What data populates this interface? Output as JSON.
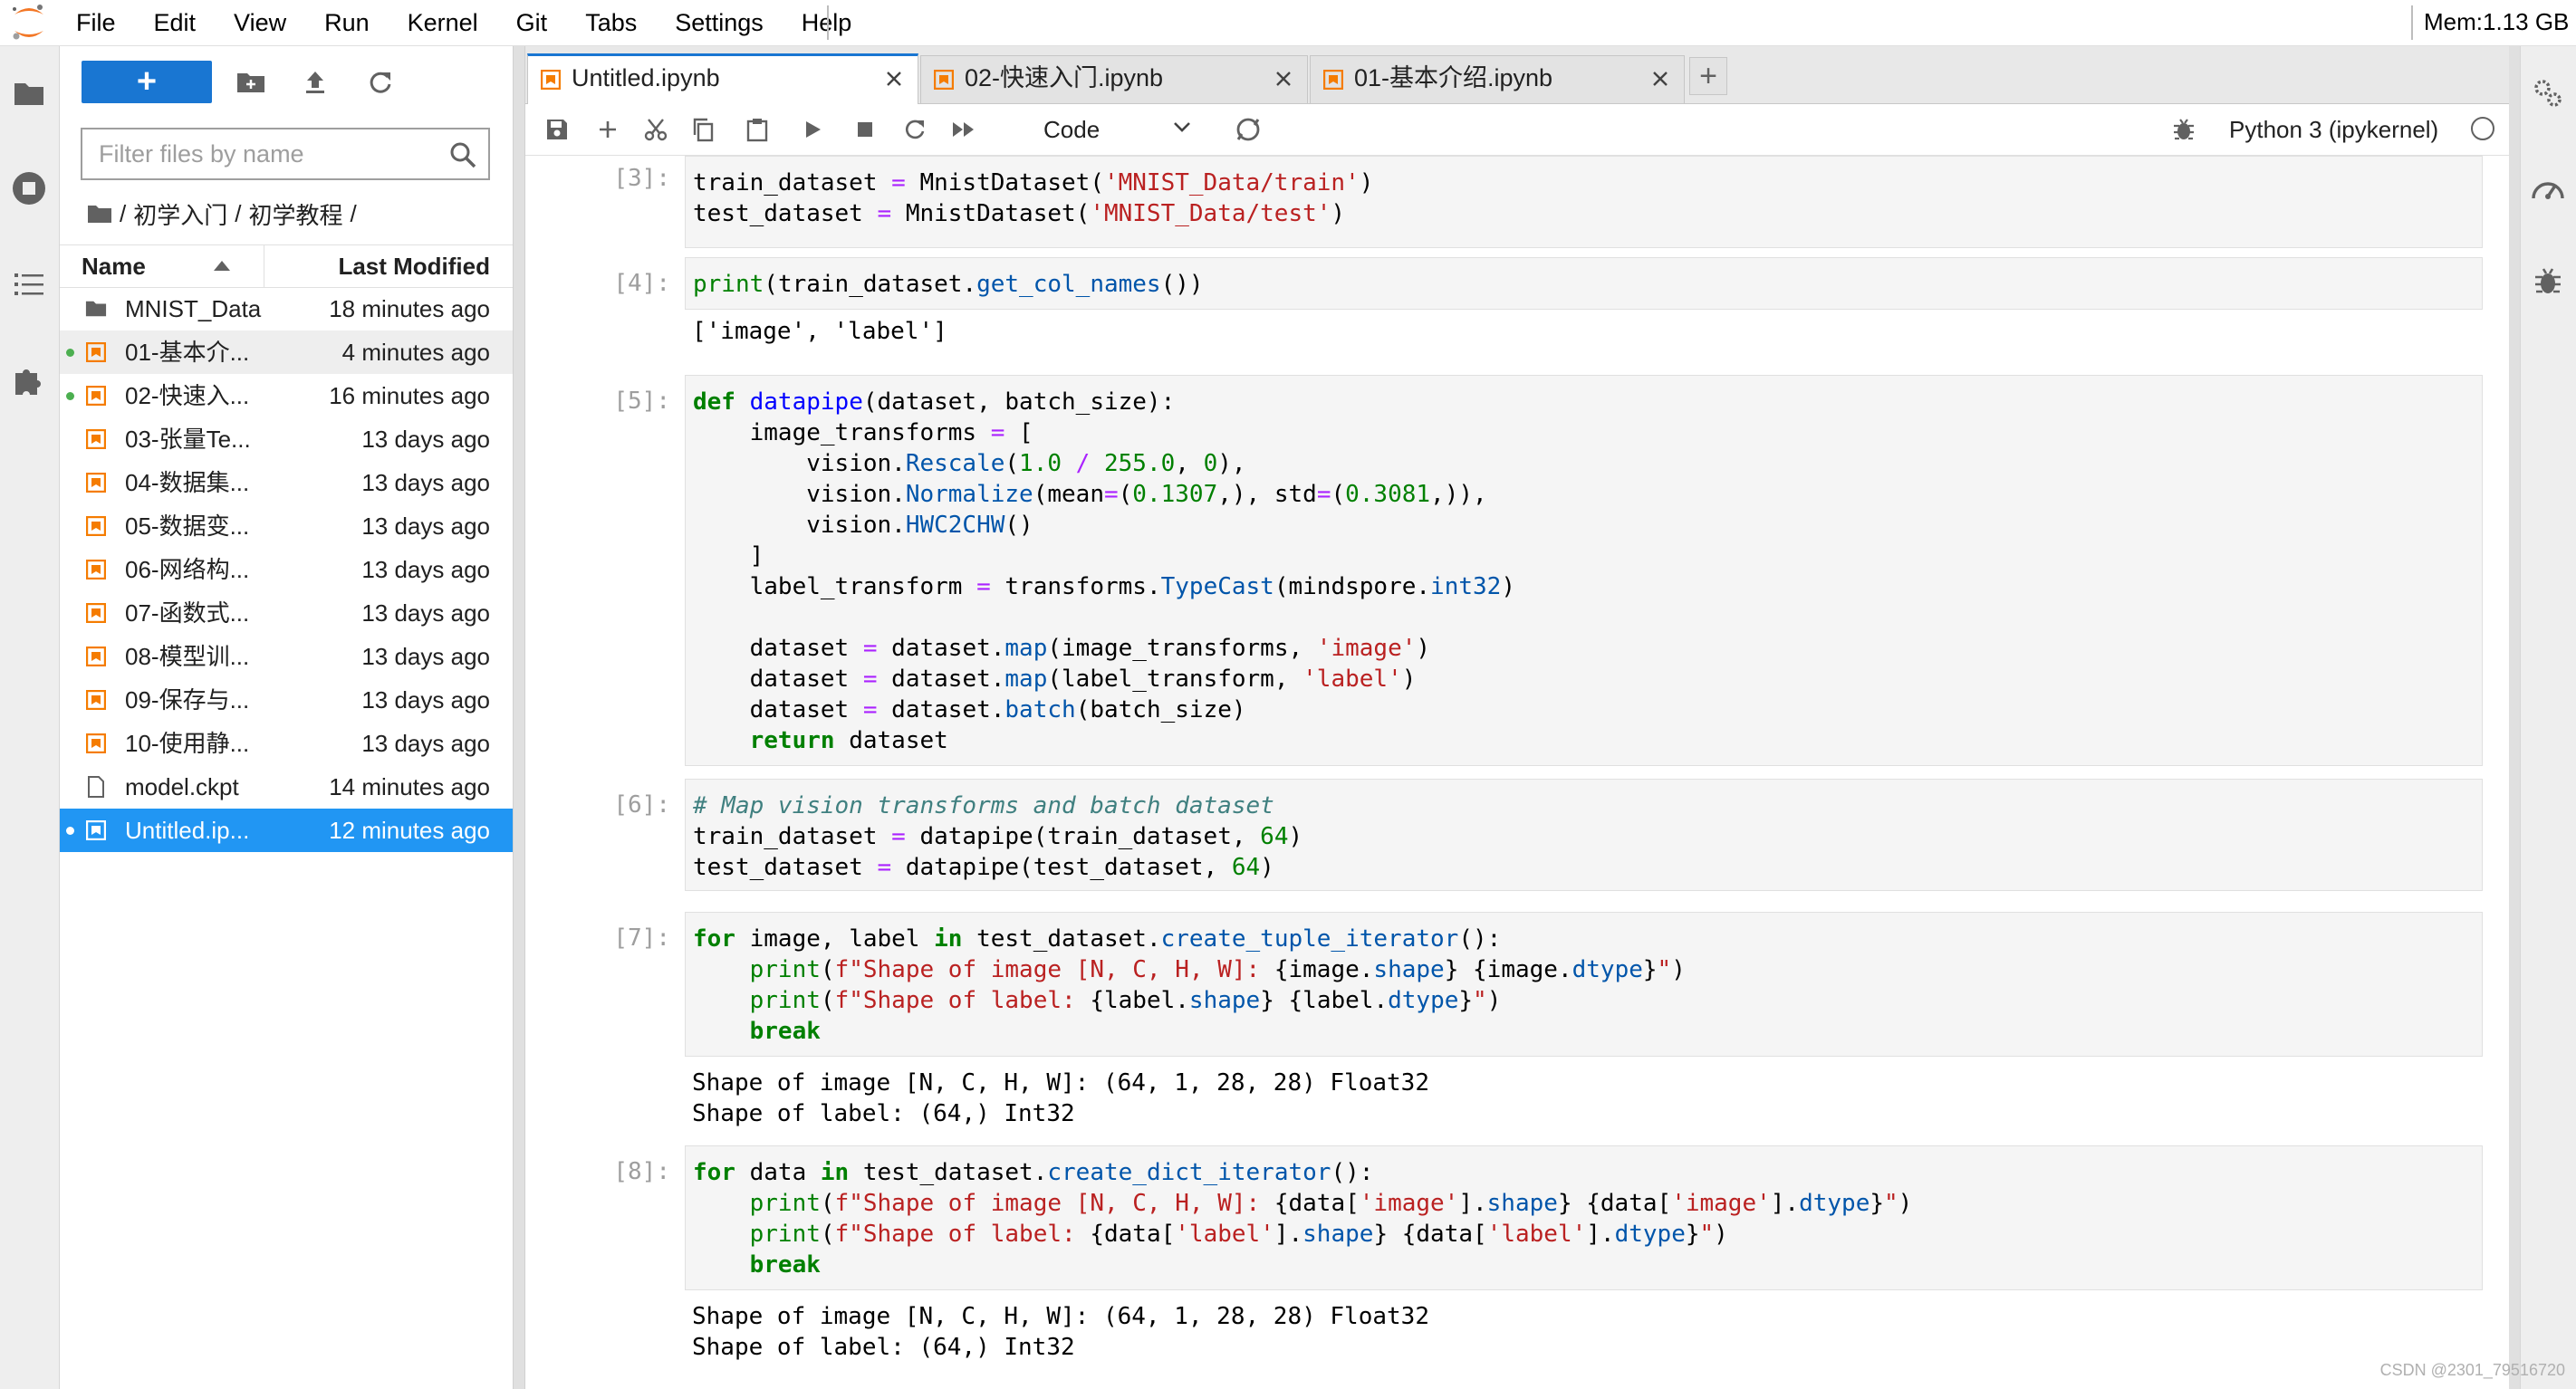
{
  "menubar": {
    "items": [
      "File",
      "Edit",
      "View",
      "Run",
      "Kernel",
      "Git",
      "Tabs",
      "Settings",
      "Help"
    ],
    "memory": "Mem:1.13 GB"
  },
  "filebrowser": {
    "new_button_label": "+",
    "filter_placeholder": "Filter files by name",
    "breadcrumb": [
      "初学入门",
      "初学教程"
    ],
    "breadcrumb_sep": "/",
    "col_name": "Name",
    "col_modified": "Last Modified",
    "files": [
      {
        "name": "MNIST_Data",
        "modified": "18 minutes ago",
        "type": "folder"
      },
      {
        "name": "01-基本介...",
        "modified": "4 minutes ago",
        "type": "notebook",
        "running": true
      },
      {
        "name": "02-快速入...",
        "modified": "16 minutes ago",
        "type": "notebook",
        "running": true
      },
      {
        "name": "03-张量Te...",
        "modified": "13 days ago",
        "type": "notebook"
      },
      {
        "name": "04-数据集...",
        "modified": "13 days ago",
        "type": "notebook"
      },
      {
        "name": "05-数据变...",
        "modified": "13 days ago",
        "type": "notebook"
      },
      {
        "name": "06-网络构...",
        "modified": "13 days ago",
        "type": "notebook"
      },
      {
        "name": "07-函数式...",
        "modified": "13 days ago",
        "type": "notebook"
      },
      {
        "name": "08-模型训...",
        "modified": "13 days ago",
        "type": "notebook"
      },
      {
        "name": "09-保存与...",
        "modified": "13 days ago",
        "type": "notebook"
      },
      {
        "name": "10-使用静...",
        "modified": "13 days ago",
        "type": "notebook"
      },
      {
        "name": "model.ckpt",
        "modified": "14 minutes ago",
        "type": "file"
      },
      {
        "name": "Untitled.ip...",
        "modified": "12 minutes ago",
        "type": "notebook",
        "running": true,
        "selected": true
      }
    ]
  },
  "tabs": [
    {
      "label": "Untitled.ipynb",
      "active": true
    },
    {
      "label": "02-快速入门.ipynb",
      "active": false
    },
    {
      "label": "01-基本介绍.ipynb",
      "active": false
    }
  ],
  "tab_add_label": "+",
  "toolbar": {
    "cell_type": "Code",
    "kernel_name": "Python 3 (ipykernel)"
  },
  "cells": [
    {
      "prompt": "[3]:"
    },
    {
      "prompt": "[4]:",
      "output": "['image', 'label']"
    },
    {
      "prompt": "[5]:"
    },
    {
      "prompt": "[6]:"
    },
    {
      "prompt": "[7]:",
      "output": "Shape of image [N, C, H, W]: (64, 1, 28, 28) Float32\nShape of label: (64,) Int32"
    },
    {
      "prompt": "[8]:",
      "output": "Shape of image [N, C, H, W]: (64, 1, 28, 28) Float32\nShape of label: (64,) Int32"
    }
  ],
  "code": {
    "c3_l1_a": "train_dataset",
    "c3_l1_b": "MnistDataset",
    "c3_l1_c": "'MNIST_Data/train'",
    "c3_l2_a": "test_dataset",
    "c3_l2_b": "MnistDataset",
    "c3_l2_c": "'MNIST_Data/test'",
    "c4_print": "print",
    "c4_obj": "train_dataset",
    "c4_fn": "get_col_names",
    "c5_def": "def",
    "c5_name": "datapipe",
    "c5_params": "(dataset, batch_size):",
    "c5_it": "image_transforms",
    "c5_vision": "vision",
    "c5_rescale": "Rescale",
    "c5_num1": "1.0",
    "c5_num2": "255.0",
    "c5_num3": "0",
    "c5_normalize": "Normalize",
    "c5_mean": "mean",
    "c5_num4": "0.1307",
    "c5_std": "std",
    "c5_num5": "0.3081",
    "c5_hwc": "HWC2CHW",
    "c5_lt": "label_transform",
    "c5_transforms": "transforms",
    "c5_typecast": "TypeCast",
    "c5_ms": "mindspore",
    "c5_int32": "int32",
    "c5_ds": "dataset",
    "c5_map": "map",
    "c5_image": "'image'",
    "c5_label": "'label'",
    "c5_batch": "batch",
    "c5_bs": "batch_size",
    "c5_return": "return",
    "c6_comment": "# Map vision transforms and batch dataset",
    "c6_train": "train_dataset",
    "c6_test": "test_dataset",
    "c6_dp": "datapipe",
    "c6_64": "64",
    "c7_for": "for",
    "c7_in": "in",
    "c7_vars": "image, label",
    "c7_obj": "test_dataset",
    "c7_fn": "create_tuple_iterator",
    "c7_print": "print",
    "c7_str1": "f\"Shape of image [N, C, H, W]: ",
    "c7_str2": "f\"Shape of label: ",
    "c7_image": "image",
    "c7_label": "label",
    "c7_shape": "shape",
    "c7_dtype": "dtype",
    "c7_break": "break",
    "c8_for": "for",
    "c8_in": "in",
    "c8_var": "data",
    "c8_obj": "test_dataset",
    "c8_fn": "create_dict_iterator",
    "c8_print": "print",
    "c8_str1": "f\"Shape of image [N, C, H, W]: ",
    "c8_str2": "f\"Shape of label: ",
    "c8_kimg": "'image'",
    "c8_klbl": "'label'",
    "c8_shape": "shape",
    "c8_dtype": "dtype",
    "c8_break": "break"
  },
  "watermark": "CSDN @2301_79516720",
  "colors": {
    "brand": "#1976d2",
    "selected": "#2196f3",
    "running": "#4caf50",
    "notebook_icon": "#f57c00"
  }
}
